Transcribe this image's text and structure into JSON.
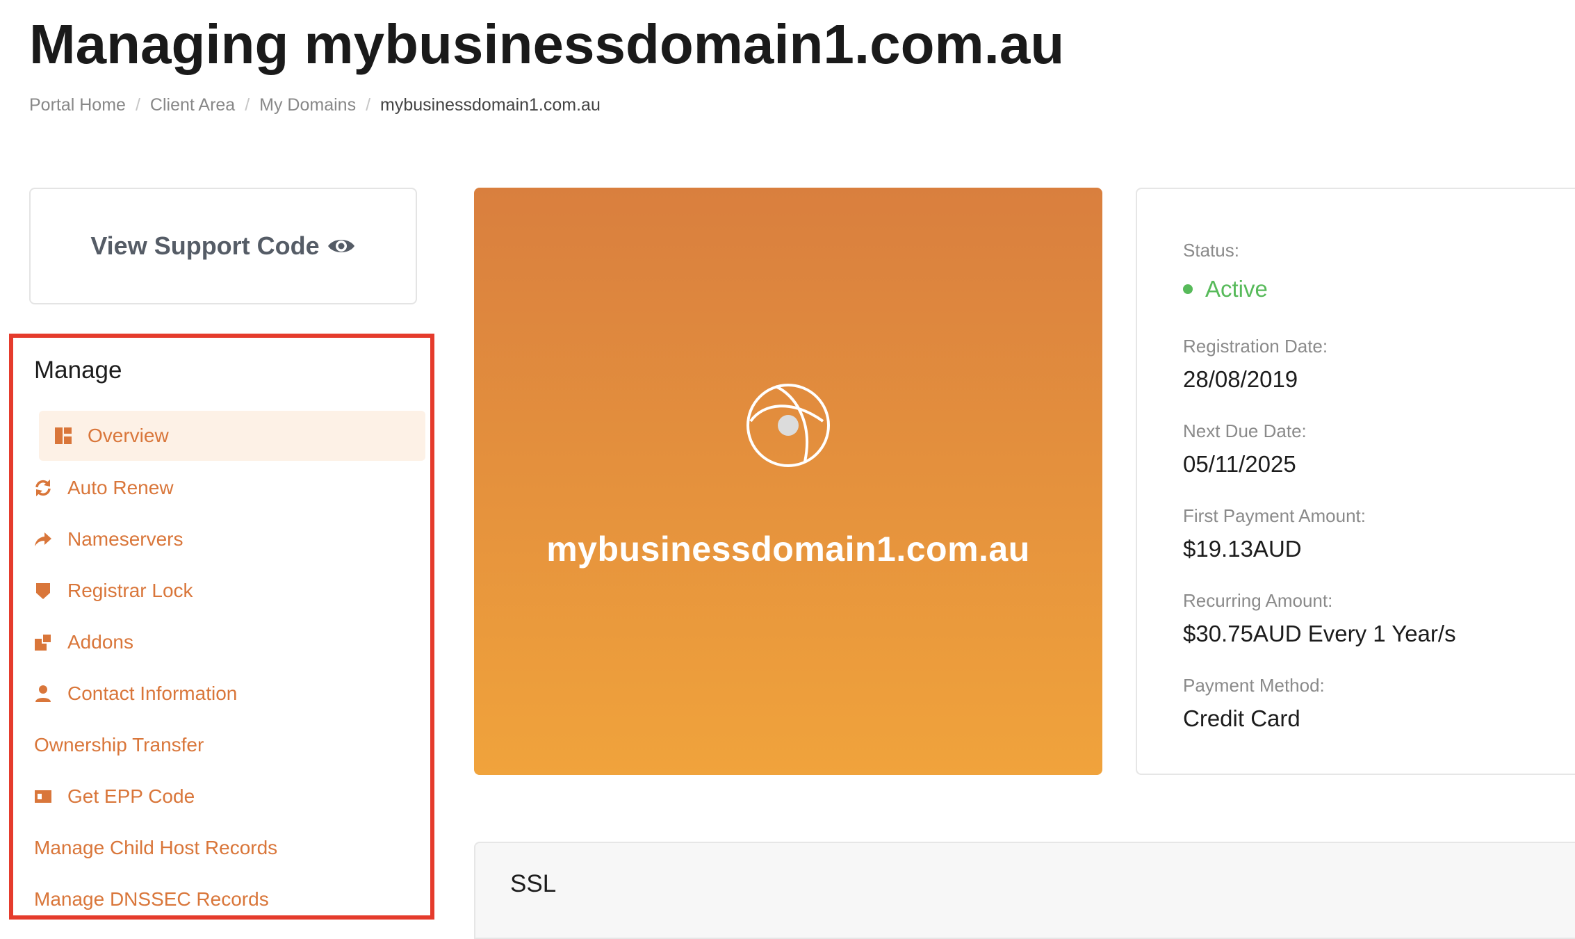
{
  "page": {
    "title": "Managing mybusinessdomain1.com.au"
  },
  "breadcrumb": {
    "items": [
      "Portal Home",
      "Client Area",
      "My Domains"
    ],
    "separator": "/",
    "current": "mybusinessdomain1.com.au"
  },
  "support": {
    "label": "View Support Code",
    "icon": "eye-icon"
  },
  "manage": {
    "heading": "Manage",
    "items": [
      {
        "label": "Overview",
        "icon": "dashboard-icon",
        "active": true
      },
      {
        "label": "Auto Renew",
        "icon": "sync-icon"
      },
      {
        "label": "Nameservers",
        "icon": "share-arrow-icon"
      },
      {
        "label": "Registrar Lock",
        "icon": "shield-icon"
      },
      {
        "label": "Addons",
        "icon": "clone-icon"
      },
      {
        "label": "Contact Information",
        "icon": "user-icon"
      },
      {
        "label": "Ownership Transfer",
        "icon": ""
      },
      {
        "label": "Get EPP Code",
        "icon": "id-card-icon"
      },
      {
        "label": "Manage Child Host Records",
        "icon": ""
      },
      {
        "label": "Manage DNSSEC Records",
        "icon": ""
      }
    ]
  },
  "domain_card": {
    "name": "mybusinessdomain1.com.au",
    "icon": "globe-icon"
  },
  "details": {
    "status_label": "Status:",
    "status_value": "Active",
    "registration_label": "Registration Date:",
    "registration_value": "28/08/2019",
    "next_due_label": "Next Due Date:",
    "next_due_value": "05/11/2025",
    "first_payment_label": "First Payment Amount:",
    "first_payment_value": "$19.13AUD",
    "recurring_label": "Recurring Amount:",
    "recurring_value": "$30.75AUD Every 1 Year/s",
    "payment_method_label": "Payment Method:",
    "payment_method_value": "Credit Card"
  },
  "ssl": {
    "title": "SSL"
  },
  "colors": {
    "accent": "#d9763a",
    "active_bg": "#fdf1e6",
    "status_green": "#57ba5a",
    "highlight_border": "#e53b2c",
    "gradient_top": "#d97f3e",
    "gradient_bottom": "#f0a33c"
  }
}
